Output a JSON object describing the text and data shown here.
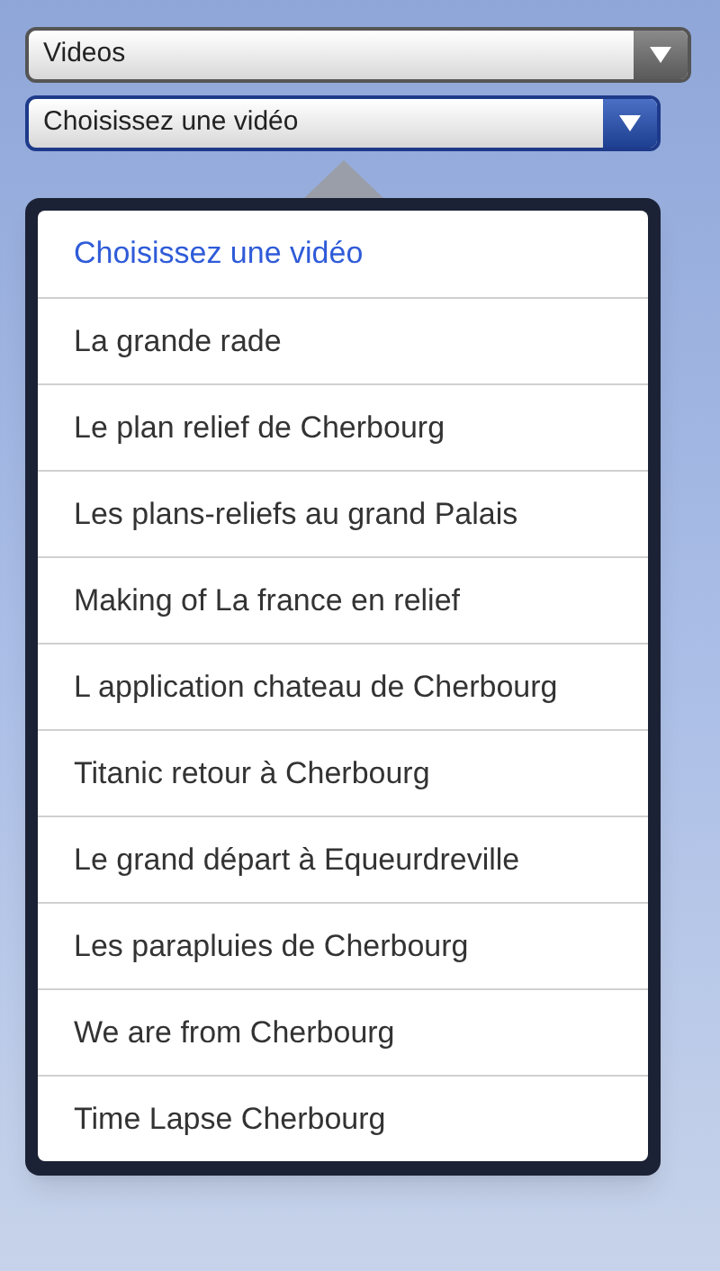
{
  "selects": [
    {
      "value": "Videos",
      "active": false
    },
    {
      "value": "Choisissez une vidéo",
      "active": true
    }
  ],
  "popover": {
    "items": [
      {
        "label": "Choisissez une vidéo",
        "selected": true
      },
      {
        "label": "La grande rade",
        "selected": false
      },
      {
        "label": "Le plan relief de Cherbourg",
        "selected": false
      },
      {
        "label": "Les plans-reliefs au grand Palais",
        "selected": false
      },
      {
        "label": "Making of La france en relief",
        "selected": false
      },
      {
        "label": "L application chateau de Cherbourg",
        "selected": false
      },
      {
        "label": "Titanic retour à Cherbourg",
        "selected": false
      },
      {
        "label": "Le grand départ à Equeurdreville",
        "selected": false
      },
      {
        "label": "Les parapluies de Cherbourg",
        "selected": false
      },
      {
        "label": "We are from Cherbourg",
        "selected": false
      },
      {
        "label": "Time Lapse Cherbourg",
        "selected": false
      }
    ]
  }
}
